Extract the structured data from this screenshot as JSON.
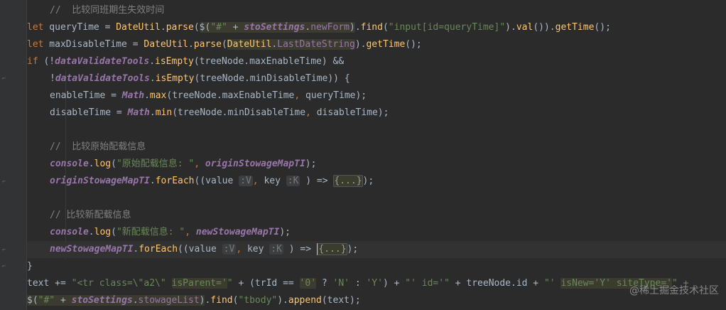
{
  "editor": {
    "watermark": "@稀土掘金技术社区"
  },
  "code": {
    "l1": {
      "comment": "//  比较同班期生失效时间"
    },
    "l2": {
      "let": "let",
      "var": " queryTime = ",
      "cls": "DateUtil",
      "dot1": ".",
      "m1": "parse",
      "p1": "(",
      "jq": "$(",
      "s1": "\"#\"",
      "plus": " + ",
      "obj": "stoSettings",
      "dot2": ".",
      "fld": "newForm",
      "p2": ")",
      "dot3": ".",
      "m2": "find",
      "p3": "(",
      "s2": "\"input[id=queryTime]\"",
      "p4": ").",
      "m3": "val",
      "p5": "()).",
      "m4": "getTime",
      "p6": "();"
    },
    "l3": {
      "let": "let",
      "var": " maxDisableTime = ",
      "cls": "DateUtil",
      "dot1": ".",
      "m1": "parse",
      "p1": "(",
      "cls2": "DateUtil",
      "dot2": ".",
      "fld": "LastDateString",
      "p2": ").",
      "m2": "getTime",
      "p3": "();"
    },
    "l4": {
      "if": "if",
      "p1": " (!",
      "obj": "dataValidateTools",
      "dot": ".",
      "m": "isEmpty",
      "rest": "(treeNode.maxEnableTime) &&"
    },
    "l5": {
      "p1": "!",
      "obj": "dataValidateTools",
      "dot": ".",
      "m": "isEmpty",
      "rest": "(treeNode.minDisableTime)) {"
    },
    "l6": {
      "a": "enableTime = ",
      "obj": "Math",
      "dot": ".",
      "m": "max",
      "b": "(treeNode.maxEnableTime",
      "comma": ",",
      "c": " queryTime);"
    },
    "l7": {
      "a": "disableTime = ",
      "obj": "Math",
      "dot": ".",
      "m": "min",
      "b": "(treeNode.minDisableTime",
      "comma": ",",
      "c": " disableTime);"
    },
    "l8": {
      "comment": "//  比较原始配载信息"
    },
    "l9": {
      "obj": "console",
      "dot": ".",
      "m": "log",
      "p1": "(",
      "s": "\"原始配载信息: \"",
      "comma": ",",
      "sp": " ",
      "arg": "originStowageMapTI",
      "p2": ");"
    },
    "l10": {
      "obj": "originStowageMapTI",
      "dot": ".",
      "m": "forEach",
      "p1": "((value",
      "sp1": " ",
      "h1": ":V",
      "comma1": ",",
      "b": " key ",
      "h2": ":K",
      "c": " ) => ",
      "fold": "{...}",
      "p2": ");"
    },
    "l11": {
      "comment": "// 比较新配载信息"
    },
    "l12": {
      "obj": "console",
      "dot": ".",
      "m": "log",
      "p1": "(",
      "s": "\"新配载信息: \"",
      "comma": ",",
      "sp": " ",
      "arg": "newStowageMapTI",
      "p2": ");"
    },
    "l13": {
      "obj": "newStowageMapTI",
      "dot": ".",
      "m": "forEach",
      "p1": "((value",
      "sp1": " ",
      "h1": ":V",
      "comma1": ",",
      "b": " key ",
      "h2": ":K",
      "c": " ) => ",
      "fold": "{...}",
      "p2": ");"
    },
    "l14": {
      "brace": "}"
    },
    "l15": {
      "a": "text += ",
      "s1": "\"<tr class=\\\"a2\\\" ",
      "s1b": "isParent='",
      "s1c": "\"",
      "b": " + (trId == ",
      "s2": "'0'",
      "c": " ? ",
      "s3": "'N'",
      "d": " : ",
      "s4": "'Y'",
      "e": ") + ",
      "s5": "\"' id='\"",
      "f": " + treeNode.id + ",
      "s6": "\"' ",
      "s6b": "isNew='Y' siteType='",
      "s6c": "\" +"
    },
    "l16": {
      "jq": "$(",
      "s1": "\"#\"",
      "plus": " + ",
      "obj": "stoSettings",
      "dot": ".",
      "fld": "stowageList",
      "p1": ")",
      "dot2": ".",
      "m1": "find",
      "p2": "(",
      "s2": "\"tbody\"",
      "p3": ").",
      "m2": "append",
      "p4": "(text);"
    }
  }
}
